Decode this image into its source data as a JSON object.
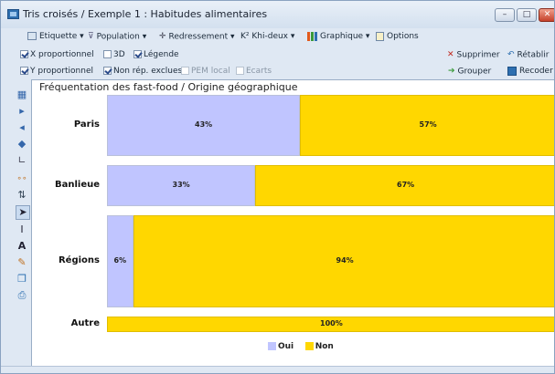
{
  "window": {
    "title": "Tris croisés / Exemple 1 : Habitudes alimentaires",
    "controls": {
      "minimize": "–",
      "maximize": "□",
      "close": "✕"
    }
  },
  "toolbar1": {
    "etiquette": "Etiquette",
    "population": "Population",
    "redressement": "Redressement",
    "khi_deux": "K² Khi-deux",
    "graphique": "Graphique",
    "options": "Options"
  },
  "toolbar2": {
    "x_proportionnel": "X proportionnel",
    "threed": "3D",
    "legende": "Légende",
    "supprimer": "Supprimer",
    "retablir": "Rétablir"
  },
  "toolbar3": {
    "y_proportionnel": "Y proportionnel",
    "non_rep_exclues": "Non rép. exclues",
    "pem_local": "PEM local",
    "ecarts": "Ecarts",
    "grouper": "Grouper",
    "recoder": "Recoder"
  },
  "checkbox_state": {
    "x_proportionnel": true,
    "threed": false,
    "legende": true,
    "y_proportionnel": true,
    "non_rep_exclues": true,
    "pem_local": false,
    "ecarts": false
  },
  "left_tools": [
    "table-icon",
    "play-icon",
    "back-icon",
    "diamond-icon",
    "axes-icon",
    "scatter-icon",
    "sort-icon",
    "pointer-icon",
    "text-cursor-icon",
    "font-icon",
    "paint-icon",
    "copy-icon",
    "print-icon"
  ],
  "colors": {
    "oui": "#c0c5ff",
    "non": "#ffd700"
  },
  "chart_data": {
    "type": "bar",
    "title": "Fréquentation des fast-food / Origine géographique",
    "categories": [
      "Paris",
      "Banlieue",
      "Régions",
      "Autre"
    ],
    "row_weights": [
      0.231,
      0.154,
      0.346,
      0.057
    ],
    "series": [
      {
        "name": "Oui",
        "values": [
          43,
          33,
          6,
          0
        ]
      },
      {
        "name": "Non",
        "values": [
          57,
          67,
          94,
          100
        ]
      }
    ],
    "value_labels": [
      [
        "43%",
        "57%"
      ],
      [
        "33%",
        "67%"
      ],
      [
        "6%",
        "94%"
      ],
      [
        "",
        "100%"
      ]
    ],
    "legend": [
      "Oui",
      "Non"
    ],
    "legend_position": "bottom"
  }
}
